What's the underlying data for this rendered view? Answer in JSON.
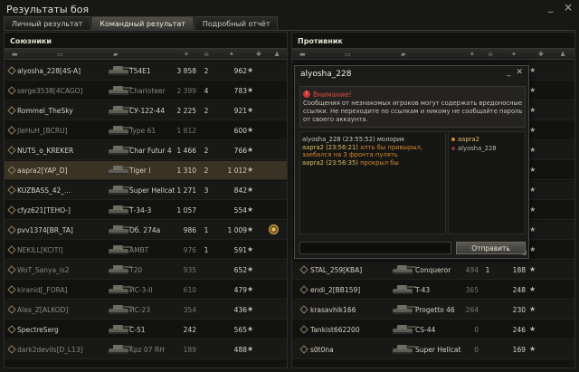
{
  "window": {
    "title": "Результаты боя",
    "minimize": "_",
    "close": "×"
  },
  "tabs": [
    "Личный результат",
    "Командный результат",
    "Подробный отчёт"
  ],
  "allies": {
    "title": "Союзники",
    "rows": [
      {
        "name": "alyosha_228[4S-A]",
        "vehicle": "T54E1",
        "damage": "3 858",
        "frags": "2",
        "xp": "962",
        "alive": true
      },
      {
        "name": "serge3538[4CAGO]",
        "vehicle": "Charioteer",
        "damage": "2 399",
        "frags": "4",
        "xp": "783",
        "alive": false
      },
      {
        "name": "Rommel_TheSky",
        "vehicle": "СУ-122-44",
        "damage": "2 225",
        "frags": "2",
        "xp": "921",
        "alive": true
      },
      {
        "name": "JleHuH_[BCRU]",
        "vehicle": "Type 61",
        "damage": "1 812",
        "frags": "",
        "xp": "600",
        "alive": false
      },
      {
        "name": "NUTS_o_KREKER",
        "vehicle": "Char Futur 4",
        "damage": "1 466",
        "frags": "2",
        "xp": "766",
        "alive": true
      },
      {
        "name": "aapra2[YAP_D]",
        "vehicle": "Tiger I",
        "damage": "1 310",
        "frags": "2",
        "xp": "1 012",
        "alive": true,
        "self": true
      },
      {
        "name": "KUZBASS_42_...",
        "vehicle": "Super Hellcat",
        "damage": "1 271",
        "frags": "3",
        "xp": "842",
        "alive": true
      },
      {
        "name": "cfyz621[TEHO-]",
        "vehicle": "Т-34-3",
        "damage": "1 057",
        "frags": "",
        "xp": "554",
        "alive": true
      },
      {
        "name": "pvv1374[BR_TA]",
        "vehicle": "Об. 274a",
        "damage": "986",
        "frags": "1",
        "xp": "1 009",
        "alive": true
      },
      {
        "name": "NEKILL[KCITI]",
        "vehicle": "AMBT",
        "damage": "976",
        "frags": "1",
        "xp": "591",
        "alive": false
      },
      {
        "name": "WoT_Sanya_is2",
        "vehicle": "T20",
        "damage": "935",
        "frags": "",
        "xp": "652",
        "alive": false
      },
      {
        "name": "kiranid[_FORA]",
        "vehicle": "ИС-3-II",
        "damage": "610",
        "frags": "",
        "xp": "479",
        "alive": false
      },
      {
        "name": "Alex_Z[ALKOD]",
        "vehicle": "ИС-23",
        "damage": "354",
        "frags": "",
        "xp": "436",
        "alive": false
      },
      {
        "name": "SpectreSerg",
        "vehicle": "C-51",
        "damage": "242",
        "frags": "",
        "xp": "565",
        "alive": true
      },
      {
        "name": "dark2devils[D_L13]",
        "vehicle": "Kpz 07 RH",
        "damage": "189",
        "frags": "",
        "xp": "488",
        "alive": false
      }
    ]
  },
  "enemies": {
    "title": "Противник",
    "rows": [
      {
        "name": "",
        "vehicle": "",
        "damage": "",
        "frags": "",
        "xp": ""
      },
      {
        "name": "",
        "vehicle": "",
        "damage": "",
        "frags": "",
        "xp": ""
      },
      {
        "name": "",
        "vehicle": "",
        "damage": "",
        "frags": "",
        "xp": ""
      },
      {
        "name": "",
        "vehicle": "",
        "damage": "",
        "frags": "",
        "xp": ""
      },
      {
        "name": "",
        "vehicle": "",
        "damage": "",
        "frags": "",
        "xp": ""
      },
      {
        "name": "",
        "vehicle": "",
        "damage": "",
        "frags": "",
        "xp": ""
      },
      {
        "name": "",
        "vehicle": "",
        "damage": "",
        "frags": "",
        "xp": ""
      },
      {
        "name": "",
        "vehicle": "",
        "damage": "",
        "frags": "",
        "xp": ""
      },
      {
        "name": "",
        "vehicle": "",
        "damage": "",
        "frags": "",
        "xp": ""
      },
      {
        "name": "",
        "vehicle": "",
        "damage": "",
        "frags": "",
        "xp": ""
      },
      {
        "name": "STAL_259[KBA]",
        "vehicle": "Conqueror",
        "damage": "494",
        "frags": "1",
        "xp": "188"
      },
      {
        "name": "endi_2[BB159]",
        "vehicle": "T-43",
        "damage": "365",
        "frags": "",
        "xp": "248"
      },
      {
        "name": "krasavhik166",
        "vehicle": "Progetto 46",
        "damage": "264",
        "frags": "",
        "xp": "230"
      },
      {
        "name": "Tankist662200",
        "vehicle": "CS-44",
        "damage": "0",
        "frags": "",
        "xp": "246"
      },
      {
        "name": "s0t0na",
        "vehicle": "Super Hellcat",
        "damage": "0",
        "frags": "",
        "xp": "169"
      }
    ]
  },
  "chat": {
    "title": "alyosha_228",
    "warning_title": "Внимание!",
    "warning_text": "Сообщения от незнакомых игроков могут содержать вредоносные ссылки. Не переходите по ссылкам и никому не сообщайте пароль от своего аккаунта.",
    "messages": [
      {
        "who": "alyosha_228 (23:55:52)",
        "text": " молорик"
      },
      {
        "who": "aapra2 (23:56:21)",
        "text": " хпть бы привырыл,"
      },
      {
        "who": "",
        "text": "заебался на 3 фронта пулять"
      },
      {
        "who": "aapra2 (23:56:35)",
        "text": " прокрыл бы"
      }
    ],
    "members": [
      "aapra2",
      "alyosha_228"
    ],
    "input_placeholder": "",
    "send_label": "Отправить"
  },
  "colors": {
    "accent": "#e0c060",
    "orange": "#d4882c",
    "warn": "#d84a3a"
  }
}
